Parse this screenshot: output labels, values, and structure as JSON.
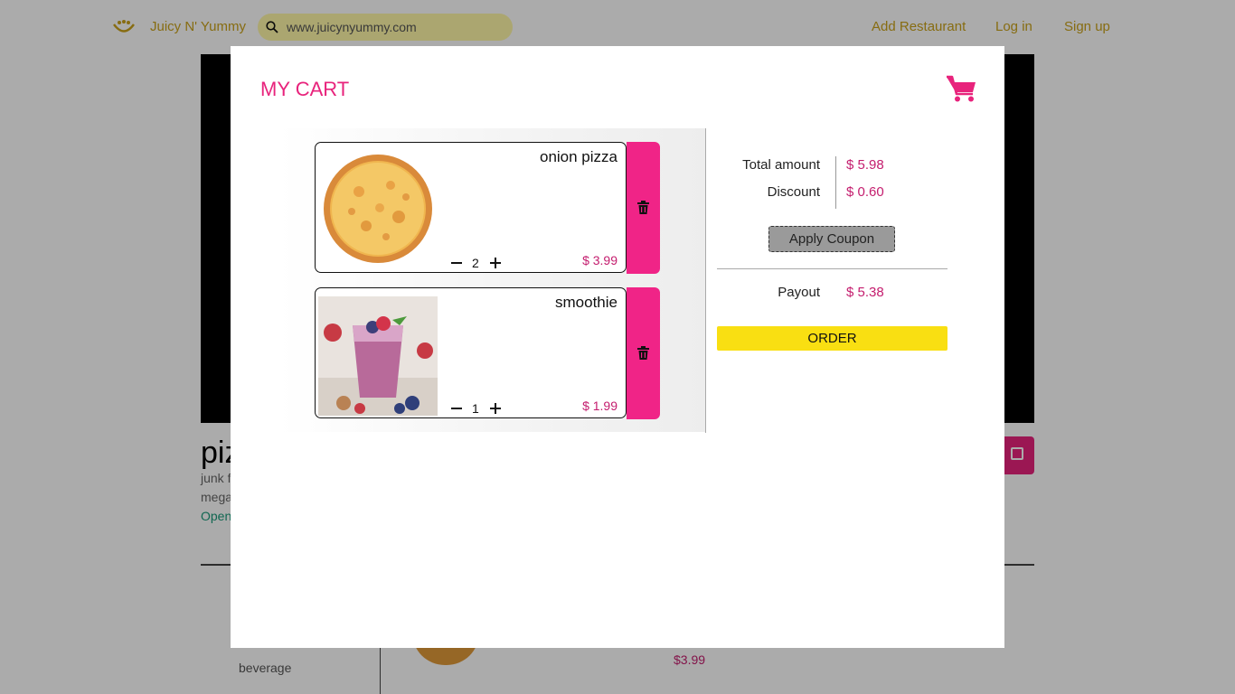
{
  "nav": {
    "brand": "Juicy N' Yummy",
    "search_value": "www.juicynyummy.com",
    "links": [
      "Add Restaurant",
      "Log in",
      "Sign up"
    ]
  },
  "restaurant": {
    "name": "piz",
    "line1": "junk f",
    "line2": "mega",
    "status": "Open",
    "category": "beverage",
    "item_price": "$3.99"
  },
  "cart": {
    "title": "MY CART",
    "items": [
      {
        "name": "onion pizza",
        "qty": "2",
        "price": "$ 3.99",
        "image": "pizza"
      },
      {
        "name": "smoothie",
        "qty": "1",
        "price": "$ 1.99",
        "image": "smoothie"
      }
    ],
    "summary": {
      "total_label": "Total amount",
      "total_value": "$ 5.98",
      "discount_label": "Discount",
      "discount_value": "$ 0.60",
      "coupon_label": "Apply Coupon",
      "payout_label": "Payout",
      "payout_value": "$ 5.38",
      "order_label": "ORDER"
    }
  },
  "colors": {
    "accent": "#e8237c",
    "price": "#c41d6e",
    "delete_tab": "#f02487",
    "order": "#f9df12",
    "nav_text": "#c9a21a",
    "search_bg": "#fff8a8"
  },
  "icons": [
    "logo-icon",
    "search-icon",
    "cart-icon",
    "trash-icon",
    "minus-icon",
    "plus-icon"
  ]
}
